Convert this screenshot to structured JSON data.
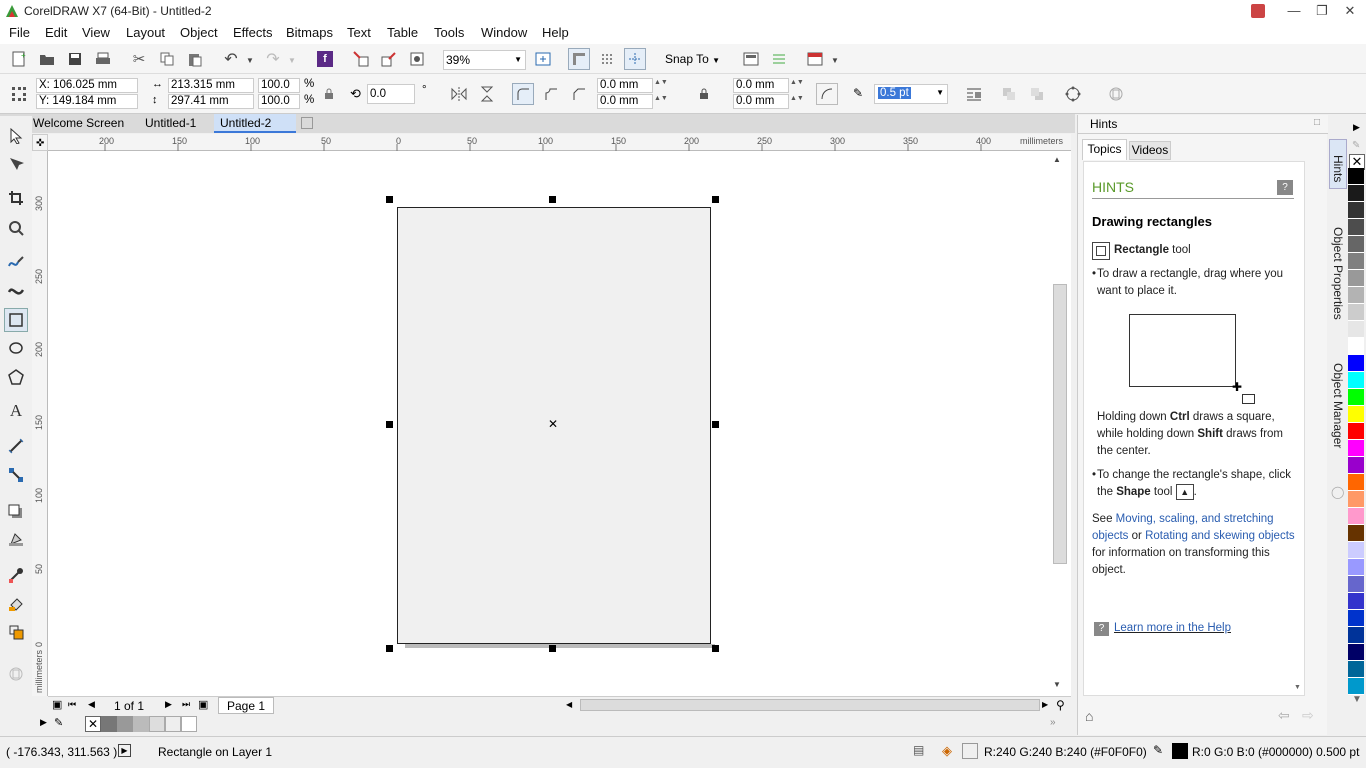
{
  "window": {
    "title": "CorelDRAW X7 (64-Bit) - Untitled-2"
  },
  "menu": [
    "File",
    "Edit",
    "View",
    "Layout",
    "Object",
    "Effects",
    "Bitmaps",
    "Text",
    "Table",
    "Tools",
    "Window",
    "Help"
  ],
  "toolbar": {
    "zoom": "39%",
    "snap_to": "Snap To"
  },
  "propbar": {
    "x": "X: 106.025 mm",
    "y": "Y: 149.184 mm",
    "w": "213.315 mm",
    "h": "297.41 mm",
    "sx": "100.0",
    "sy": "100.0",
    "pct": "%",
    "angle": "0.0",
    "deg": "°",
    "c1": "0.0 mm",
    "c2": "0.0 mm",
    "c3": "0.0 mm",
    "c4": "0.0 mm",
    "outline": "0.5 pt"
  },
  "tabs": [
    "Welcome Screen",
    "Untitled-1",
    "Untitled-2"
  ],
  "ruler": {
    "units": "millimeters",
    "h_ticks": [
      "200",
      "150",
      "100",
      "50",
      "0",
      "50",
      "100",
      "150",
      "200",
      "250",
      "300",
      "350",
      "400"
    ],
    "v_ticks": [
      "300",
      "250",
      "200",
      "150",
      "100",
      "50",
      "0"
    ]
  },
  "pagenav": {
    "count": "1 of 1",
    "page_tab": "Page 1"
  },
  "docker": {
    "title": "Hints",
    "tabs": [
      "Topics",
      "Videos"
    ],
    "header": "HINTS",
    "heading": "Drawing rectangles",
    "tool_name": "Rectangle",
    "tool_word": " tool",
    "bullet1": "To draw a rectangle, drag where you want to place it.",
    "p1_a": "Holding down ",
    "p1_b": "Ctrl",
    "p1_c": " draws a square, while holding down ",
    "p1_d": "Shift",
    "p1_e": " draws from the center.",
    "b2_a": "To change the rectangle's shape, click the ",
    "b2_b": "Shape",
    "b2_c": " tool",
    "see": "See ",
    "link1": "Moving, scaling, and stretching objects",
    "or": " or ",
    "link2": "Rotating and skewing objects",
    "see_end": " for information on transforming this object.",
    "learn": "Learn more in the Help",
    "side_tabs": [
      "Hints",
      "Object Properties",
      "Object Manager"
    ]
  },
  "status": {
    "coords": "( -176.343, 311.563 )",
    "info": "Rectangle on Layer 1",
    "fill": "R:240 G:240 B:240 (#F0F0F0)",
    "outline": "R:0 G:0 B:0 (#000000)  0.500 pt"
  },
  "palette": [
    "#000000",
    "#1a1a1a",
    "#333333",
    "#4d4d4d",
    "#666666",
    "#808080",
    "#999999",
    "#b3b3b3",
    "#cccccc",
    "#e6e6e6",
    "#ffffff",
    "#0000ff",
    "#00ffff",
    "#00ff00",
    "#ffff00",
    "#ff0000",
    "#ff00ff",
    "#9900cc",
    "#ff6600",
    "#ff9966",
    "#ff99cc",
    "#663300",
    "#ccccff",
    "#9999ff",
    "#6666cc",
    "#3333cc",
    "#0033cc",
    "#003399",
    "#000066",
    "#006699",
    "#0099cc"
  ],
  "colors": {
    "accent": "#2a5db0",
    "hints_green": "#5a9a2a",
    "page_fill": "#f0f0f0"
  }
}
